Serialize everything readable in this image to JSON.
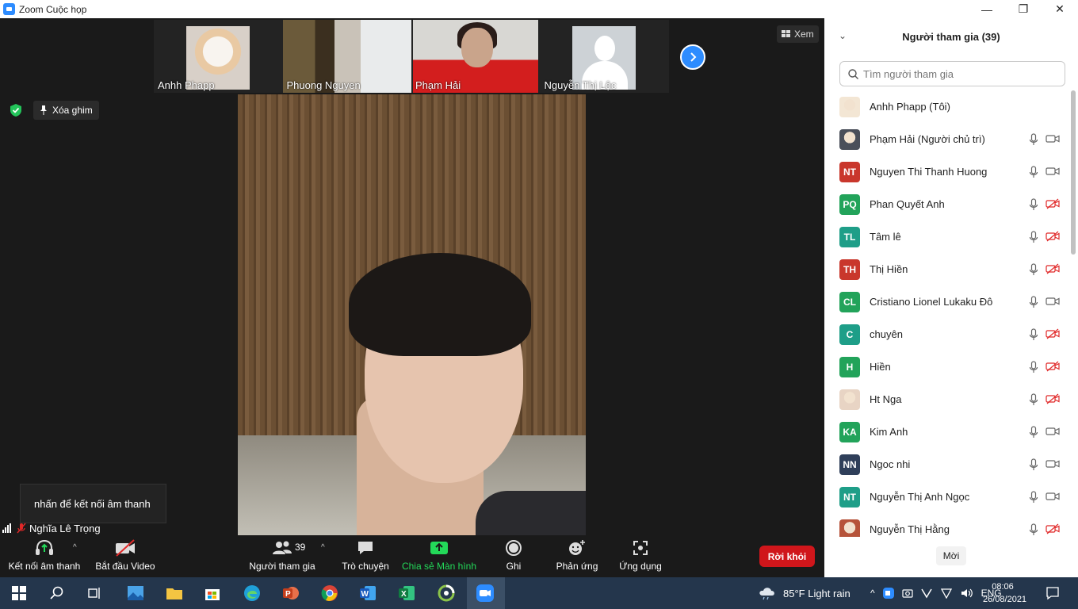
{
  "window": {
    "title": "Zoom Cuộc họp",
    "minimize": "—",
    "maximize": "❐",
    "close": "✕"
  },
  "thumbnails": [
    {
      "name": "Anhh Phapp"
    },
    {
      "name": "Phuong Nguyen"
    },
    {
      "name": "Phạm Hải"
    },
    {
      "name": "Nguyễn Thị Lộc"
    }
  ],
  "view_label": "Xem",
  "unpin_label": "Xóa ghim",
  "audio_tooltip": "nhấn để kết nối âm thanh",
  "active_speaker_name": "Nghĩa Lê Trọng",
  "toolbar": {
    "join_audio": "Kết nối âm thanh",
    "start_video": "Bắt đầu Video",
    "participants": "Người tham gia",
    "participants_count": "39",
    "chat": "Trò chuyện",
    "share_screen": "Chia sẻ Màn hình",
    "record": "Ghi",
    "reactions": "Phản ứng",
    "apps": "Ứng dụng",
    "leave": "Rời khỏi"
  },
  "panel": {
    "title": "Người tham gia (39)",
    "search_placeholder": "Tìm người tham gia",
    "invite": "Mời",
    "participants": [
      {
        "initials": "",
        "name": "Anhh Phapp (Tôi)",
        "color": "#f3e6d4",
        "photo": true,
        "mic": false,
        "cam_off": null
      },
      {
        "initials": "",
        "name": "Phạm Hải (Người chủ trì)",
        "color": "#4a4f5a",
        "photo": true,
        "mic": true,
        "cam_off": false
      },
      {
        "initials": "NT",
        "name": "Nguyen Thi Thanh Huong",
        "color": "#c9372c",
        "mic": true,
        "cam_off": false
      },
      {
        "initials": "PQ",
        "name": "Phan Quyết Anh",
        "color": "#22a35a",
        "mic": true,
        "cam_off": true
      },
      {
        "initials": "TL",
        "name": "Tâm lê",
        "color": "#1e9e88",
        "mic": true,
        "cam_off": true
      },
      {
        "initials": "TH",
        "name": "Thị Hiền",
        "color": "#c9372c",
        "mic": true,
        "cam_off": true
      },
      {
        "initials": "CL",
        "name": "Cristiano Lionel Lukaku Đô",
        "color": "#22a35a",
        "mic": true,
        "cam_off": false
      },
      {
        "initials": "C",
        "name": "chuyên",
        "color": "#1e9e88",
        "mic": true,
        "cam_off": true
      },
      {
        "initials": "H",
        "name": "Hiền",
        "color": "#22a35a",
        "mic": true,
        "cam_off": true
      },
      {
        "initials": "",
        "name": "Ht Nga",
        "color": "#e8d4c4",
        "photo": true,
        "mic": true,
        "cam_off": true
      },
      {
        "initials": "KA",
        "name": "Kim Anh",
        "color": "#22a35a",
        "mic": true,
        "cam_off": false
      },
      {
        "initials": "NN",
        "name": "Ngoc nhi",
        "color": "#2f3f5a",
        "mic": true,
        "cam_off": false
      },
      {
        "initials": "NT",
        "name": "Nguyễn Thị Anh Ngọc",
        "color": "#1e9e88",
        "mic": true,
        "cam_off": false
      },
      {
        "initials": "",
        "name": "Nguyễn Thị Hằng",
        "color": "#b6533a",
        "photo": true,
        "mic": true,
        "cam_off": true
      }
    ]
  },
  "taskbar": {
    "weather": "85°F  Light rain",
    "time": "08:06",
    "date": "26/08/2021"
  },
  "colors": {
    "accent": "#2d8cff",
    "leave": "#d0161b",
    "share": "#23d959",
    "mute_red": "#e02828"
  }
}
